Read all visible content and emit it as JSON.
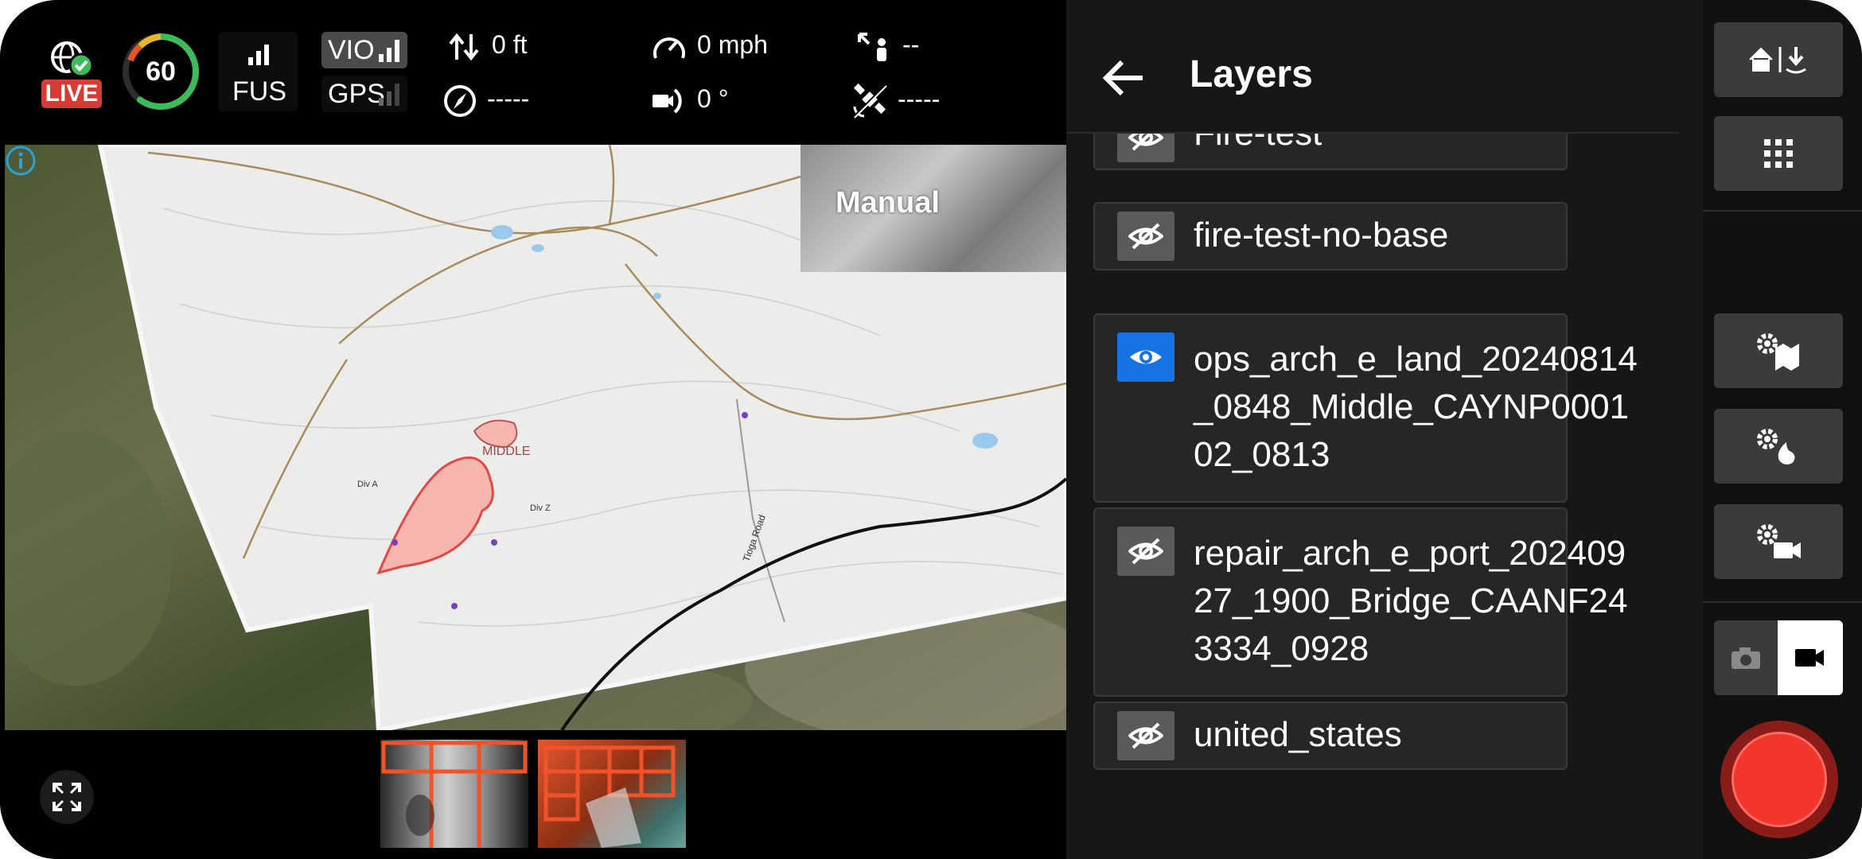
{
  "status_bar": {
    "live_label": "LIVE",
    "battery_percent": 60,
    "battery_label": "60",
    "fus_label": "FUS",
    "vio_label": "VIO",
    "gps_label": "GPS",
    "altitude": "0 ft",
    "speed": "0 mph",
    "distance": "--",
    "heading": "-----",
    "camera_tilt": "0 °",
    "satellites": "-----"
  },
  "map": {
    "overlay_label": "Manual",
    "labels": {
      "fire_name": "MIDDLE",
      "div_a": "Div A",
      "div_z": "Div Z",
      "road": "Tioga Road"
    }
  },
  "layers_panel": {
    "title": "Layers",
    "layers": [
      {
        "name": "Fire-test",
        "visible": false
      },
      {
        "name": "fire-test-no-base",
        "visible": false
      },
      {
        "name": "ops_arch_e_land_20240814_0848_Middle_CAYNP000102_0813",
        "visible": true
      },
      {
        "name": "repair_arch_e_port_20240927_1900_Bridge_CAANF243334_0928",
        "visible": false
      },
      {
        "name": "united_states",
        "visible": false
      }
    ]
  },
  "colors": {
    "accent_blue": "#1673e6",
    "live_red": "#d93a33",
    "record_red": "#f2362c",
    "fire_fill": "#f7b5b0"
  },
  "icons": [
    "globe-check-icon",
    "battery-ring-icon",
    "signal-icon",
    "altitude-icon",
    "speedometer-icon",
    "distance-person-icon",
    "compass-icon",
    "camera-tilt-icon",
    "satellite-icon",
    "info-icon",
    "expand-icon",
    "back-arrow-icon",
    "eye-off-icon",
    "eye-icon",
    "home-download-icon",
    "grid-icon",
    "gear-map-icon",
    "gear-fire-icon",
    "gear-video-icon",
    "camera-icon",
    "video-icon"
  ]
}
